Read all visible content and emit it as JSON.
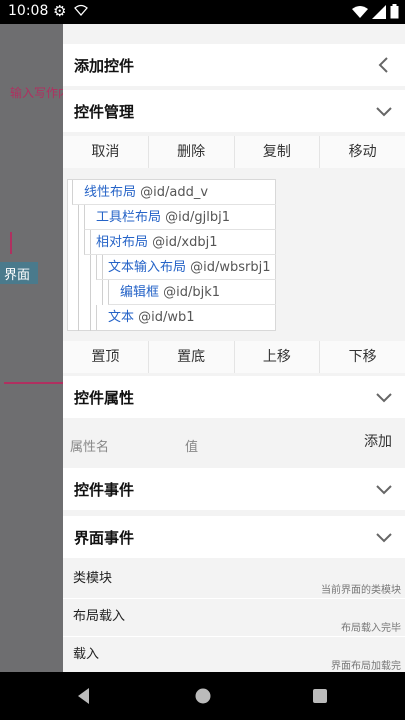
{
  "status_bar": {
    "time": "10:08"
  },
  "background": {
    "hint": "输入写作内",
    "tag": "界面"
  },
  "drawer": {
    "add_control": {
      "title": "添加控件"
    },
    "control_mgmt": {
      "title": "控件管理",
      "buttons": [
        "取消",
        "删除",
        "复制",
        "移动"
      ],
      "tree": [
        {
          "name": "线性布局",
          "id": "@id/add_v"
        },
        {
          "name": "工具栏布局",
          "id": "@id/gjlbj1"
        },
        {
          "name": "相对布局",
          "id": "@id/xdbj1"
        },
        {
          "name": "文本输入布局",
          "id": "@id/wbsrbj1"
        },
        {
          "name": "编辑框",
          "id": "@id/bjk1"
        },
        {
          "name": "文本",
          "id": "@id/wb1"
        }
      ],
      "move_buttons": [
        "置顶",
        "置底",
        "上移",
        "下移"
      ]
    },
    "control_props": {
      "title": "控件属性",
      "key_label": "属性名",
      "value_label": "值",
      "add_label": "添加"
    },
    "control_events": {
      "title": "控件事件"
    },
    "ui_events": {
      "title": "界面事件",
      "rows": [
        {
          "name": "类模块",
          "desc": "当前界面的类模块"
        },
        {
          "name": "布局载入",
          "desc": "布局载入完毕"
        },
        {
          "name": "载入",
          "desc": "界面布局加载完"
        }
      ]
    }
  }
}
